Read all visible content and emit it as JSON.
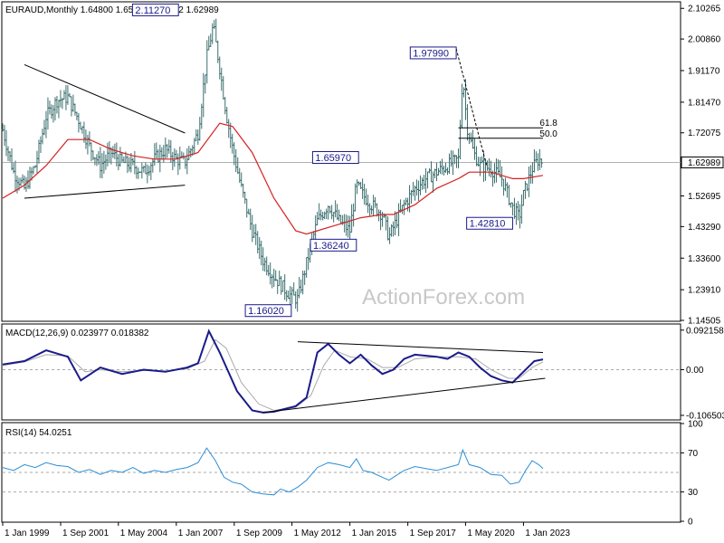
{
  "chart_data": [
    {
      "panel": "price",
      "type": "bar",
      "header": "EURAUD,Monthly  1.64800 1.65263 1.62902 1.62989",
      "current_price": "1.62989",
      "y_ticks": [
        "2.10265",
        "2.00860",
        "1.91170",
        "1.81470",
        "1.72075",
        "1.62989",
        "1.52695",
        "1.43290",
        "1.33600",
        "1.23910",
        "1.14505"
      ],
      "ylim": [
        1.14505,
        2.12
      ],
      "x_ticks": [
        "1 Jan 1999",
        "1 Sep 2001",
        "1 May 2004",
        "1 Jan 2007",
        "1 Sep 2009",
        "1 May 2012",
        "1 Jan 2015",
        "1 Sep 2017",
        "1 May 2020",
        "1 Jan 2023"
      ],
      "xlim": [
        1999.0,
        2023.9
      ],
      "price_path": [
        [
          1999.0,
          1.73
        ],
        [
          1999.5,
          1.6
        ],
        [
          2000.0,
          1.55
        ],
        [
          2000.5,
          1.62
        ],
        [
          2001.0,
          1.77
        ],
        [
          2001.5,
          1.82
        ],
        [
          2002.0,
          1.83
        ],
        [
          2002.5,
          1.76
        ],
        [
          2003.0,
          1.68
        ],
        [
          2003.5,
          1.62
        ],
        [
          2004.0,
          1.66
        ],
        [
          2004.5,
          1.63
        ],
        [
          2005.0,
          1.62
        ],
        [
          2005.5,
          1.6
        ],
        [
          2006.0,
          1.64
        ],
        [
          2006.5,
          1.67
        ],
        [
          2007.0,
          1.64
        ],
        [
          2007.4,
          1.63
        ],
        [
          2008.0,
          1.72
        ],
        [
          2008.4,
          1.95
        ],
        [
          2008.7,
          2.05
        ],
        [
          2009.0,
          1.92
        ],
        [
          2009.3,
          1.78
        ],
        [
          2009.6,
          1.67
        ],
        [
          2010.0,
          1.55
        ],
        [
          2010.5,
          1.42
        ],
        [
          2011.0,
          1.33
        ],
        [
          2011.5,
          1.28
        ],
        [
          2012.0,
          1.24
        ],
        [
          2012.3,
          1.22
        ],
        [
          2012.6,
          1.21
        ],
        [
          2013.0,
          1.32
        ],
        [
          2013.5,
          1.45
        ],
        [
          2014.0,
          1.5
        ],
        [
          2014.5,
          1.45
        ],
        [
          2015.0,
          1.42
        ],
        [
          2015.3,
          1.56
        ],
        [
          2015.6,
          1.53
        ],
        [
          2016.0,
          1.5
        ],
        [
          2016.5,
          1.47
        ],
        [
          2016.8,
          1.4
        ],
        [
          2017.0,
          1.43
        ],
        [
          2017.5,
          1.5
        ],
        [
          2018.0,
          1.55
        ],
        [
          2018.5,
          1.58
        ],
        [
          2019.0,
          1.6
        ],
        [
          2019.5,
          1.62
        ],
        [
          2020.0,
          1.64
        ],
        [
          2020.2,
          1.9
        ],
        [
          2020.4,
          1.74
        ],
        [
          2020.7,
          1.66
        ],
        [
          2021.0,
          1.62
        ],
        [
          2021.5,
          1.61
        ],
        [
          2022.0,
          1.58
        ],
        [
          2022.5,
          1.49
        ],
        [
          2022.8,
          1.46
        ],
        [
          2023.0,
          1.53
        ],
        [
          2023.4,
          1.61
        ],
        [
          2023.7,
          1.64
        ],
        [
          2023.9,
          1.63
        ]
      ],
      "moving_average_path": [
        [
          1999.0,
          1.52
        ],
        [
          2000.0,
          1.56
        ],
        [
          2001.0,
          1.62
        ],
        [
          2002.0,
          1.7
        ],
        [
          2003.0,
          1.7
        ],
        [
          2004.0,
          1.67
        ],
        [
          2005.0,
          1.65
        ],
        [
          2006.0,
          1.64
        ],
        [
          2007.0,
          1.64
        ],
        [
          2008.0,
          1.66
        ],
        [
          2009.0,
          1.75
        ],
        [
          2009.6,
          1.74
        ],
        [
          2010.5,
          1.66
        ],
        [
          2011.5,
          1.52
        ],
        [
          2012.5,
          1.42
        ],
        [
          2013.0,
          1.41
        ],
        [
          2013.5,
          1.42
        ],
        [
          2014.5,
          1.44
        ],
        [
          2015.5,
          1.46
        ],
        [
          2016.5,
          1.47
        ],
        [
          2017.0,
          1.47
        ],
        [
          2018.0,
          1.5
        ],
        [
          2019.0,
          1.55
        ],
        [
          2020.0,
          1.58
        ],
        [
          2020.5,
          1.6
        ],
        [
          2021.5,
          1.6
        ],
        [
          2022.0,
          1.59
        ],
        [
          2022.5,
          1.58
        ],
        [
          2023.0,
          1.58
        ],
        [
          2023.9,
          1.59
        ]
      ],
      "trendlines": [
        {
          "style": "solid",
          "points": [
            [
              2000.0,
              1.93
            ],
            [
              2007.4,
              1.72
            ]
          ]
        },
        {
          "style": "solid",
          "points": [
            [
              2000.0,
              1.52
            ],
            [
              2007.4,
              1.56
            ]
          ]
        },
        {
          "style": "dashed",
          "points": [
            [
              2019.9,
              1.979
            ],
            [
              2021.3,
              1.62
            ]
          ]
        },
        {
          "style": "solid",
          "points": [
            [
              2020.0,
              1.736
            ],
            [
              2023.9,
              1.736
            ]
          ]
        },
        {
          "style": "solid",
          "points": [
            [
              2020.0,
              1.704
            ],
            [
              2023.9,
              1.704
            ]
          ]
        }
      ],
      "level_labels": [
        {
          "text": "61.8",
          "price": 1.736,
          "year": 2023.75
        },
        {
          "text": "50.0",
          "price": 1.704,
          "year": 2023.75
        }
      ],
      "annotations": [
        {
          "text": "2.11270",
          "year": 2007.1,
          "price": 2.098,
          "align": "right"
        },
        {
          "text": "1.97990",
          "year": 2019.9,
          "price": 1.966,
          "align": "right"
        },
        {
          "text": "1.65970",
          "year": 2015.4,
          "price": 1.645,
          "align": "right"
        },
        {
          "text": "1.36240",
          "year": 2015.3,
          "price": 1.376,
          "align": "right"
        },
        {
          "text": "1.42810",
          "year": 2022.5,
          "price": 1.443,
          "align": "right"
        },
        {
          "text": "1.16020",
          "year": 2012.3,
          "price": 1.175,
          "align": "right"
        }
      ],
      "watermark": "ActionForex.com"
    },
    {
      "panel": "macd",
      "type": "line",
      "header": "MACD(12,26,9) 0.023977 0.018382",
      "y_ticks": [
        "0.092158",
        "0.00",
        "-0.106503"
      ],
      "ylim": [
        -0.115,
        0.098
      ],
      "zero_line": 0.0,
      "macd_path": [
        [
          1999.0,
          0.012
        ],
        [
          2000.0,
          0.02
        ],
        [
          2001.0,
          0.045
        ],
        [
          2002.0,
          0.03
        ],
        [
          2002.6,
          -0.025
        ],
        [
          2003.5,
          0.005
        ],
        [
          2004.5,
          -0.01
        ],
        [
          2005.5,
          0.0
        ],
        [
          2006.5,
          -0.005
        ],
        [
          2007.5,
          0.005
        ],
        [
          2008.0,
          0.015
        ],
        [
          2008.5,
          0.09
        ],
        [
          2009.0,
          0.04
        ],
        [
          2009.8,
          -0.05
        ],
        [
          2010.5,
          -0.095
        ],
        [
          2011.0,
          -0.1
        ],
        [
          2011.5,
          -0.098
        ],
        [
          2012.5,
          -0.085
        ],
        [
          2013.0,
          -0.065
        ],
        [
          2013.5,
          0.04
        ],
        [
          2014.0,
          0.06
        ],
        [
          2014.5,
          0.035
        ],
        [
          2015.0,
          0.015
        ],
        [
          2015.5,
          0.035
        ],
        [
          2016.0,
          0.01
        ],
        [
          2016.5,
          -0.01
        ],
        [
          2017.0,
          0.0
        ],
        [
          2017.5,
          0.025
        ],
        [
          2018.0,
          0.035
        ],
        [
          2019.0,
          0.03
        ],
        [
          2019.5,
          0.025
        ],
        [
          2020.0,
          0.04
        ],
        [
          2020.5,
          0.03
        ],
        [
          2021.0,
          0.005
        ],
        [
          2021.5,
          -0.015
        ],
        [
          2022.0,
          -0.025
        ],
        [
          2022.5,
          -0.03
        ],
        [
          2023.0,
          -0.005
        ],
        [
          2023.5,
          0.02
        ],
        [
          2023.9,
          0.024
        ]
      ],
      "signal_path": [
        [
          1999.0,
          0.01
        ],
        [
          2000.0,
          0.018
        ],
        [
          2001.0,
          0.035
        ],
        [
          2002.0,
          0.032
        ],
        [
          2002.8,
          -0.005
        ],
        [
          2003.5,
          0.0
        ],
        [
          2004.5,
          -0.005
        ],
        [
          2005.5,
          -0.002
        ],
        [
          2006.5,
          -0.003
        ],
        [
          2007.5,
          0.002
        ],
        [
          2008.3,
          0.02
        ],
        [
          2008.8,
          0.07
        ],
        [
          2009.3,
          0.05
        ],
        [
          2010.0,
          -0.03
        ],
        [
          2010.8,
          -0.08
        ],
        [
          2011.5,
          -0.095
        ],
        [
          2012.5,
          -0.088
        ],
        [
          2013.2,
          -0.06
        ],
        [
          2013.8,
          0.01
        ],
        [
          2014.3,
          0.045
        ],
        [
          2015.0,
          0.03
        ],
        [
          2015.8,
          0.025
        ],
        [
          2016.5,
          0.005
        ],
        [
          2017.2,
          0.005
        ],
        [
          2018.0,
          0.025
        ],
        [
          2019.0,
          0.03
        ],
        [
          2020.0,
          0.03
        ],
        [
          2020.8,
          0.025
        ],
        [
          2021.5,
          0.0
        ],
        [
          2022.3,
          -0.02
        ],
        [
          2022.8,
          -0.02
        ],
        [
          2023.4,
          0.005
        ],
        [
          2023.9,
          0.018
        ]
      ],
      "trendlines": [
        {
          "points": [
            [
              2012.6,
              0.065
            ],
            [
              2023.9,
              0.04
            ]
          ]
        },
        {
          "points": [
            [
              2011.0,
              -0.1
            ],
            [
              2024.0,
              -0.02
            ]
          ]
        }
      ]
    },
    {
      "panel": "rsi",
      "type": "line",
      "header": "RSI(14) 54.0251",
      "y_ticks": [
        "100",
        "70",
        "30",
        "0"
      ],
      "ylim": [
        0,
        100
      ],
      "levels": [
        70,
        50,
        30
      ],
      "rsi_path": [
        [
          1999.0,
          55
        ],
        [
          1999.5,
          52
        ],
        [
          2000.0,
          58
        ],
        [
          2000.5,
          55
        ],
        [
          2001.0,
          60
        ],
        [
          2001.5,
          57
        ],
        [
          2002.0,
          56
        ],
        [
          2002.5,
          50
        ],
        [
          2003.0,
          53
        ],
        [
          2003.5,
          48
        ],
        [
          2004.0,
          52
        ],
        [
          2004.5,
          50
        ],
        [
          2005.0,
          55
        ],
        [
          2005.5,
          49
        ],
        [
          2006.0,
          52
        ],
        [
          2006.5,
          50
        ],
        [
          2007.0,
          53
        ],
        [
          2007.5,
          55
        ],
        [
          2008.0,
          60
        ],
        [
          2008.4,
          75
        ],
        [
          2008.8,
          62
        ],
        [
          2009.2,
          45
        ],
        [
          2009.6,
          40
        ],
        [
          2010.0,
          38
        ],
        [
          2010.5,
          30
        ],
        [
          2011.0,
          28
        ],
        [
          2011.5,
          27
        ],
        [
          2011.8,
          33
        ],
        [
          2012.2,
          30
        ],
        [
          2012.6,
          35
        ],
        [
          2013.0,
          42
        ],
        [
          2013.5,
          55
        ],
        [
          2014.0,
          60
        ],
        [
          2014.5,
          58
        ],
        [
          2015.0,
          55
        ],
        [
          2015.3,
          64
        ],
        [
          2015.6,
          52
        ],
        [
          2016.0,
          50
        ],
        [
          2016.5,
          45
        ],
        [
          2016.8,
          42
        ],
        [
          2017.0,
          45
        ],
        [
          2017.5,
          52
        ],
        [
          2018.0,
          56
        ],
        [
          2018.5,
          54
        ],
        [
          2019.0,
          52
        ],
        [
          2019.5,
          55
        ],
        [
          2020.0,
          58
        ],
        [
          2020.2,
          73
        ],
        [
          2020.5,
          58
        ],
        [
          2021.0,
          55
        ],
        [
          2021.5,
          48
        ],
        [
          2022.0,
          47
        ],
        [
          2022.4,
          38
        ],
        [
          2022.8,
          40
        ],
        [
          2023.1,
          52
        ],
        [
          2023.4,
          62
        ],
        [
          2023.7,
          58
        ],
        [
          2023.9,
          54
        ]
      ]
    }
  ]
}
